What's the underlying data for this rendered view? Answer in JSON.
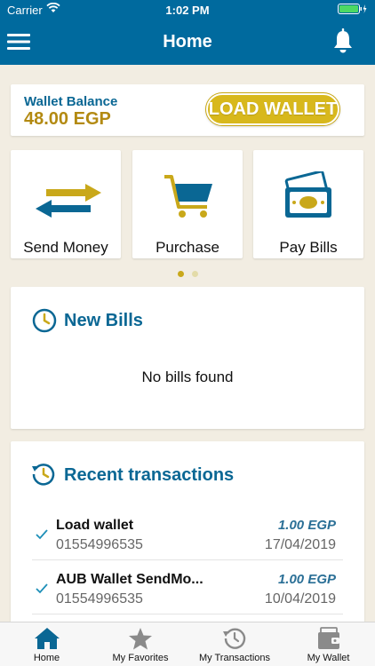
{
  "status_bar": {
    "carrier": "Carrier",
    "time": "1:02 PM"
  },
  "header": {
    "title": "Home"
  },
  "wallet": {
    "label": "Wallet Balance",
    "amount": "48.00 EGP",
    "load_button": "LOAD WALLET"
  },
  "actions": [
    {
      "label": "Send Money",
      "icon": "transfer-arrows-icon"
    },
    {
      "label": "Purchase",
      "icon": "shopping-cart-icon"
    },
    {
      "label": "Pay Bills",
      "icon": "bills-cash-icon"
    }
  ],
  "pager": {
    "pages": 2,
    "active": 1
  },
  "new_bills": {
    "title": "New Bills",
    "empty_text": "No bills found"
  },
  "recent_transactions": {
    "title": "Recent transactions",
    "items": [
      {
        "title": "Load wallet",
        "phone": "01554996535",
        "amount": "1.00 EGP",
        "date": "17/04/2019"
      },
      {
        "title": "AUB Wallet SendMo...",
        "phone": "01554996535",
        "amount": "1.00 EGP",
        "date": "10/04/2019"
      }
    ]
  },
  "tabs": [
    {
      "label": "Home",
      "icon": "home-icon",
      "active": true
    },
    {
      "label": "My Favorites",
      "icon": "star-icon",
      "active": false
    },
    {
      "label": "My Transactions",
      "icon": "history-icon",
      "active": false
    },
    {
      "label": "My Wallet",
      "icon": "wallet-icon",
      "active": false
    }
  ],
  "colors": {
    "primary": "#006a9e",
    "accent": "#d8b81c",
    "background": "#f2ede2"
  }
}
